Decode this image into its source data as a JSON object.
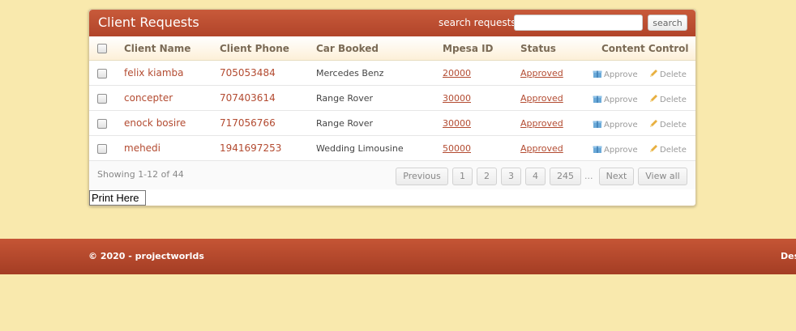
{
  "panel": {
    "title": "Client Requests",
    "search_label": "search requests",
    "search_value": "",
    "search_button": "search"
  },
  "table": {
    "columns": [
      "Client Name",
      "Client Phone",
      "Car Booked",
      "Mpesa ID",
      "Status",
      "Content Control"
    ],
    "rows": [
      {
        "name": "felix kiamba",
        "phone": "705053484",
        "car": "Mercedes Benz",
        "mpesa": "20000",
        "status": "Approved"
      },
      {
        "name": "concepter",
        "phone": "707403614",
        "car": "Range Rover",
        "mpesa": "30000",
        "status": "Approved"
      },
      {
        "name": "enock bosire",
        "phone": "717056766",
        "car": "Range Rover",
        "mpesa": "30000",
        "status": "Approved"
      },
      {
        "name": "mehedi",
        "phone": "1941697253",
        "car": "Wedding Limousine",
        "mpesa": "50000",
        "status": "Approved"
      }
    ],
    "approve_label": "Approve",
    "delete_label": "Delete"
  },
  "pagination": {
    "showing": "Showing 1-12 of 44",
    "previous": "Previous",
    "pages": [
      "1",
      "2",
      "3",
      "4",
      "245"
    ],
    "ellipsis": "...",
    "next": "Next",
    "view_all": "View all"
  },
  "print_button": "Print Here",
  "footer": {
    "copyright": "© 2020 - projectworlds",
    "right_text": "Des"
  },
  "colors": {
    "background": "#f9e9ad",
    "header": "#b9482d",
    "accent_text": "#b34b31"
  }
}
